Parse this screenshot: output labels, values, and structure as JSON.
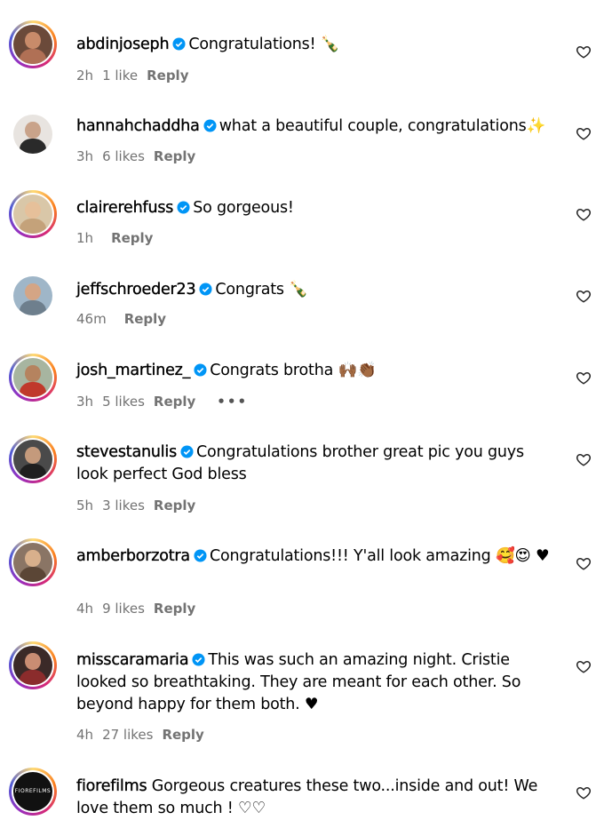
{
  "comments": [
    {
      "username": "abdinjoseph",
      "verified": true,
      "text": "Congratulations! 🍾",
      "time": "2h",
      "likes": "1 like",
      "reply": "Reply",
      "more": ""
    },
    {
      "username": "hannahchaddha",
      "verified": true,
      "text": "what a beautiful couple, congratulations✨",
      "time": "3h",
      "likes": "6 likes",
      "reply": "Reply",
      "more": ""
    },
    {
      "username": "clairerehfuss",
      "verified": true,
      "text": "So gorgeous!",
      "time": "1h",
      "likes": "",
      "reply": "Reply",
      "more": ""
    },
    {
      "username": "jeffschroeder23",
      "verified": true,
      "text": "Congrats 🍾",
      "time": "46m",
      "likes": "",
      "reply": "Reply",
      "more": ""
    },
    {
      "username": "josh_martinez_",
      "verified": true,
      "text": "Congrats brotha 🙌🏾👏🏾",
      "time": "3h",
      "likes": "5 likes",
      "reply": "Reply",
      "more": "•••"
    },
    {
      "username": "stevestanulis",
      "verified": true,
      "text": "Congratulations brother great pic you guys look perfect God bless",
      "time": "5h",
      "likes": "3 likes",
      "reply": "Reply",
      "more": ""
    },
    {
      "username": "amberborzotra",
      "verified": true,
      "text": "Congratulations!!! Y'all look amazing 🥰😍 ♥",
      "time": "4h",
      "likes": "9 likes",
      "reply": "Reply",
      "more": ""
    },
    {
      "username": "misscaramaria",
      "verified": true,
      "text": "This was such an amazing night. Cristie looked so breathtaking. They are meant for each other. So beyond happy for them both. ♥",
      "time": "4h",
      "likes": "27 likes",
      "reply": "Reply",
      "more": ""
    },
    {
      "username": "fiorefilms",
      "verified": false,
      "text": "Gorgeous creatures these two...inside and out! We love them so much ! ♡♡",
      "time": "",
      "likes": "",
      "reply": "",
      "more": "",
      "avatar_text": "FIOREFILMS"
    }
  ],
  "colors": {
    "verified": "#0095f6",
    "meta": "#737373"
  },
  "icons": {
    "like": "heart-outline-icon",
    "verified": "verified-badge-icon"
  }
}
